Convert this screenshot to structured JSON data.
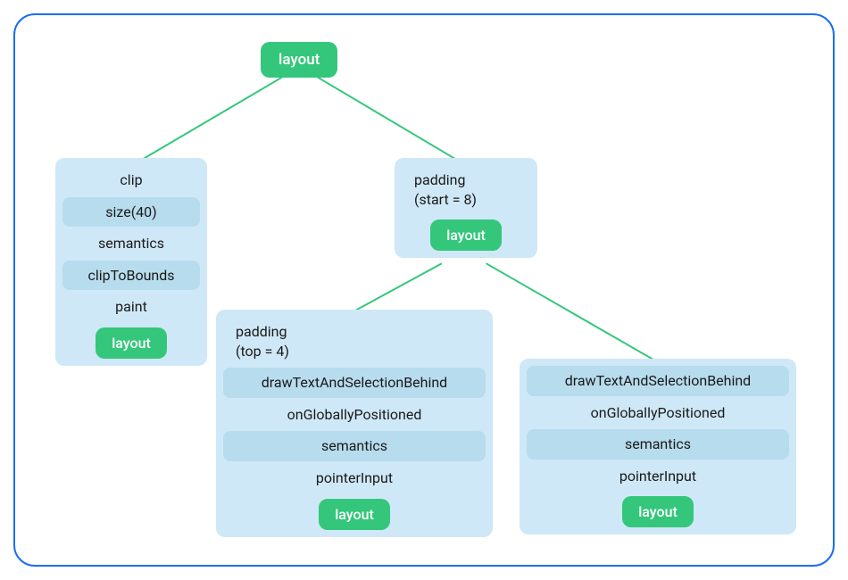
{
  "root": {
    "label": "layout"
  },
  "nodeA": {
    "rows": {
      "clip": "clip",
      "size": "size(40)",
      "semantics": "semantics",
      "clipToBounds": "clipToBounds",
      "paint": "paint"
    },
    "layout": "layout"
  },
  "nodeB": {
    "rows": {
      "padding_l1": "padding",
      "padding_l2": "(start = 8)"
    },
    "layout": "layout"
  },
  "nodeC": {
    "rows": {
      "padding_l1": "padding",
      "padding_l2": "(top = 4)",
      "draw": "drawTextAndSelectionBehind",
      "ogp": "onGloballyPositioned",
      "semantics": "semantics",
      "pointer": "pointerInput"
    },
    "layout": "layout"
  },
  "nodeD": {
    "rows": {
      "draw": "drawTextAndSelectionBehind",
      "ogp": "onGloballyPositioned",
      "semantics": "semantics",
      "pointer": "pointerInput"
    },
    "layout": "layout"
  }
}
